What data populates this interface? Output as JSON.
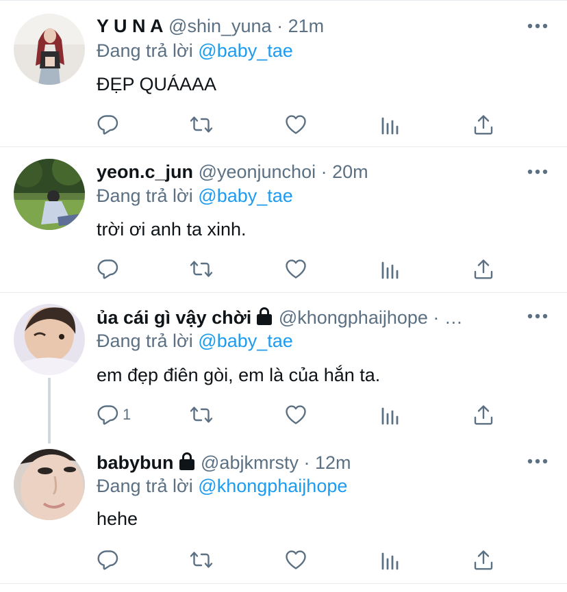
{
  "icons": {
    "reply": "reply-icon",
    "retweet": "retweet-icon",
    "like": "like-icon",
    "analytics": "analytics-icon",
    "share": "share-icon",
    "more": "more-icon",
    "lock": "lock-icon"
  },
  "colors": {
    "accent": "#1d9bf0",
    "secondary_text": "#5b7083",
    "divider": "#e6ecf0"
  },
  "tweets": [
    {
      "name": "Y U N A",
      "handle": "@shin_yuna",
      "separator": "·",
      "time": "21m",
      "reply_prefix": "Đang trả lời",
      "reply_to": "@baby_tae",
      "text": "ĐẸP QUÁAAA",
      "reply_count": ""
    },
    {
      "name": "yeon.c_jun",
      "handle": "@yeonjunchoi",
      "separator": "·",
      "time": "20m",
      "reply_prefix": "Đang trả lời",
      "reply_to": "@baby_tae",
      "text": "trời ơi anh ta xinh.",
      "reply_count": ""
    },
    {
      "name": "ủa cái gì vậy chời",
      "handle": "@khongphaijhope",
      "separator": "· …",
      "time": "",
      "reply_prefix": "Đang trả lời",
      "reply_to": "@baby_tae",
      "text": "em đẹp điên gòi, em là của hắn ta.",
      "reply_count": "1"
    },
    {
      "name": "babybun",
      "handle": "@abjkmrsty",
      "separator": "·",
      "time": "12m",
      "reply_prefix": "Đang trả lời",
      "reply_to": "@khongphaijhope",
      "text": "hehe",
      "reply_count": ""
    }
  ]
}
